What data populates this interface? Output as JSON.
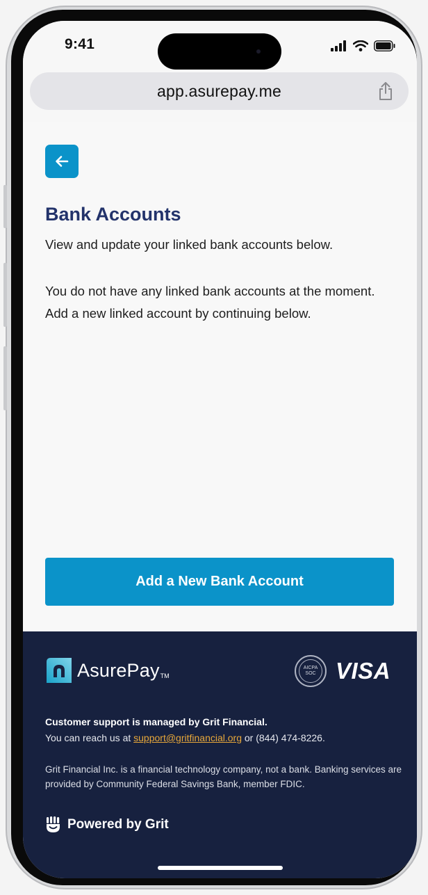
{
  "status_bar": {
    "time": "9:41"
  },
  "browser": {
    "url": "app.asurepay.me"
  },
  "page": {
    "title": "Bank Accounts",
    "subtitle": "View and update your linked bank accounts below.",
    "empty_message": "You do not have any linked bank accounts at the moment. Add a new linked account by continuing below.",
    "add_button_label": "Add a New Bank Account"
  },
  "footer": {
    "logo_text": "AsurePay",
    "logo_tm": "TM",
    "soc_badge_top": "AICPA",
    "soc_badge_bottom": "SOC",
    "visa_label": "VISA",
    "support_title": "Customer support is managed by Grit Financial.",
    "support_prefix": "You can reach us at ",
    "support_email": "support@gritfinancial.org",
    "support_suffix": " or (844) 474-8226.",
    "disclaimer": "Grit Financial Inc. is a financial technology company, not a bank. Banking services are provided by Community Federal Savings Bank, member FDIC.",
    "powered_by": "Powered by Grit"
  },
  "colors": {
    "accent": "#0b93c9",
    "title": "#23336b",
    "footer_bg": "#17213f",
    "link": "#e8a83a"
  },
  "icons": [
    "signal-icon",
    "wifi-icon",
    "battery-icon",
    "share-icon",
    "back-arrow-icon",
    "asurepay-logo-icon",
    "grit-logo-icon"
  ]
}
